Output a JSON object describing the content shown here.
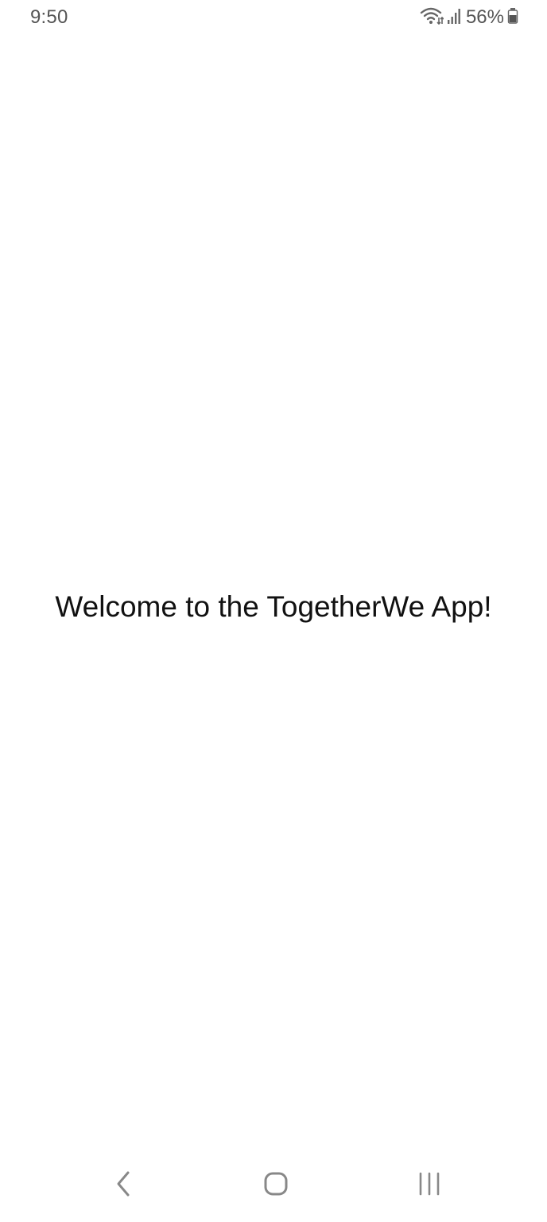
{
  "status_bar": {
    "time": "9:50",
    "battery_percent": "56%",
    "icons": [
      "wifi-icon",
      "signal-icon",
      "battery-icon"
    ],
    "color": "#555555"
  },
  "main": {
    "welcome_text": "Welcome to the TogetherWe App!"
  },
  "nav_bar": {
    "buttons": [
      "back-icon",
      "home-icon",
      "recents-icon"
    ],
    "color": "#888888"
  }
}
